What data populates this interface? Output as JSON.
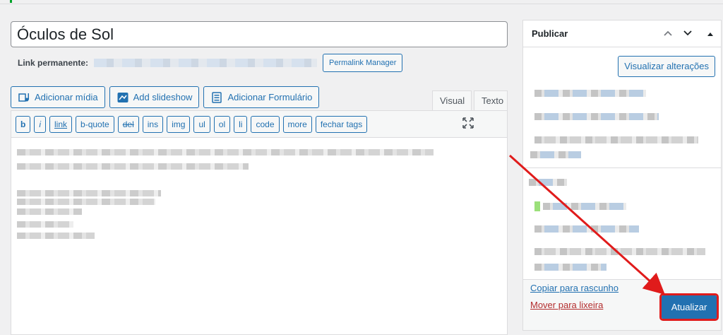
{
  "post": {
    "title": "Óculos de Sol",
    "permalink_label": "Link permanente:",
    "permalink_button": "Permalink Manager"
  },
  "media_buttons": [
    {
      "label": "Adicionar mídia",
      "icon": "media-icon"
    },
    {
      "label": "Add slideshow",
      "icon": "slideshow-icon"
    },
    {
      "label": "Adicionar Formulário",
      "icon": "form-icon"
    }
  ],
  "editor": {
    "tabs": [
      "Visual",
      "Texto"
    ],
    "quicktags": [
      "b",
      "i",
      "link",
      "b-quote",
      "del",
      "ins",
      "img",
      "ul",
      "ol",
      "li",
      "code",
      "more",
      "fechar tags"
    ],
    "fullscreen_icon": "fullscreen-icon"
  },
  "publish": {
    "title": "Publicar",
    "preview_button": "Visualizar alterações",
    "copy_draft_link": "Copiar para rascunho",
    "trash_link": "Mover para lixeira",
    "update_button": "Atualizar"
  },
  "colors": {
    "accent": "#2271b1",
    "highlight": "#e01b1b",
    "danger": "#b32d2e"
  }
}
